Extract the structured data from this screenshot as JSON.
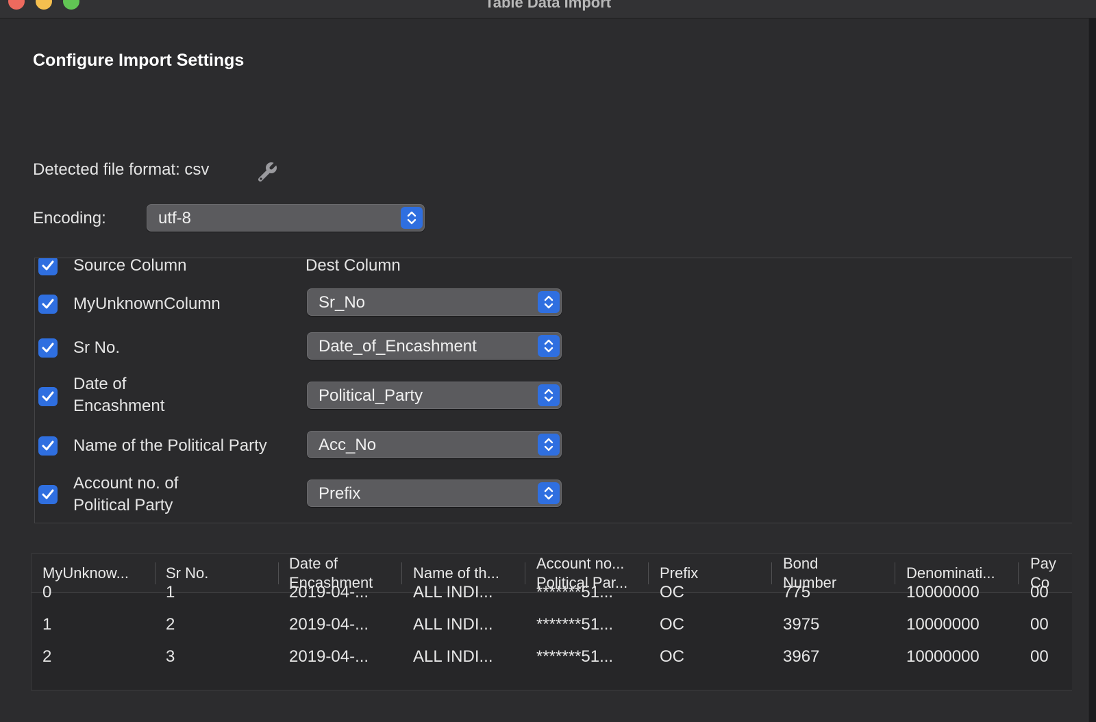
{
  "window": {
    "title": "Table Data Import"
  },
  "header": {
    "title": "Configure Import Settings"
  },
  "format": {
    "label": "Detected file format: csv"
  },
  "encoding": {
    "label": "Encoding:",
    "value": "utf-8"
  },
  "mapping": {
    "header_source": "Source Column",
    "header_dest": "Dest Column",
    "rows": [
      {
        "source_line1": "MyUnknownColumn",
        "source_line2": "",
        "dest": "Sr_No"
      },
      {
        "source_line1": "Sr No.",
        "source_line2": "",
        "dest": "Date_of_Encashment"
      },
      {
        "source_line1": "Date of",
        "source_line2": "Encashment",
        "dest": "Political_Party"
      },
      {
        "source_line1": "Name of the Political Party",
        "source_line2": "",
        "dest": "Acc_No"
      },
      {
        "source_line1": "Account no. of",
        "source_line2": "Political Party",
        "dest": "Prefix"
      }
    ]
  },
  "preview": {
    "columns": [
      {
        "line1": "MyUnknow...",
        "line2": ""
      },
      {
        "line1": "Sr No.",
        "line2": ""
      },
      {
        "line1": "Date of",
        "line2": "Encashment"
      },
      {
        "line1": "Name of th...",
        "line2": ""
      },
      {
        "line1": "Account no...",
        "line2": "Political Par..."
      },
      {
        "line1": "Prefix",
        "line2": ""
      },
      {
        "line1": "Bond",
        "line2": "Number"
      },
      {
        "line1": "Denominati...",
        "line2": ""
      },
      {
        "line1": "Pay",
        "line2": "Co"
      }
    ],
    "rows": [
      [
        "0",
        "1",
        "2019-04-...",
        "ALL INDI...",
        "*******51...",
        "OC",
        "775",
        "10000000",
        "00"
      ],
      [
        "1",
        "2",
        "2019-04-...",
        "ALL INDI...",
        "*******51...",
        "OC",
        "3975",
        "10000000",
        "00"
      ],
      [
        "2",
        "3",
        "2019-04-...",
        "ALL INDI...",
        "*******51...",
        "OC",
        "3967",
        "10000000",
        "00"
      ]
    ]
  },
  "icons": {
    "wrench": "wrench-icon",
    "checkbox": "checkmark-icon",
    "stepper": "chevron-up-down-icon"
  },
  "colors": {
    "accent": "#2f6fe0",
    "background": "#2c2c2e"
  }
}
